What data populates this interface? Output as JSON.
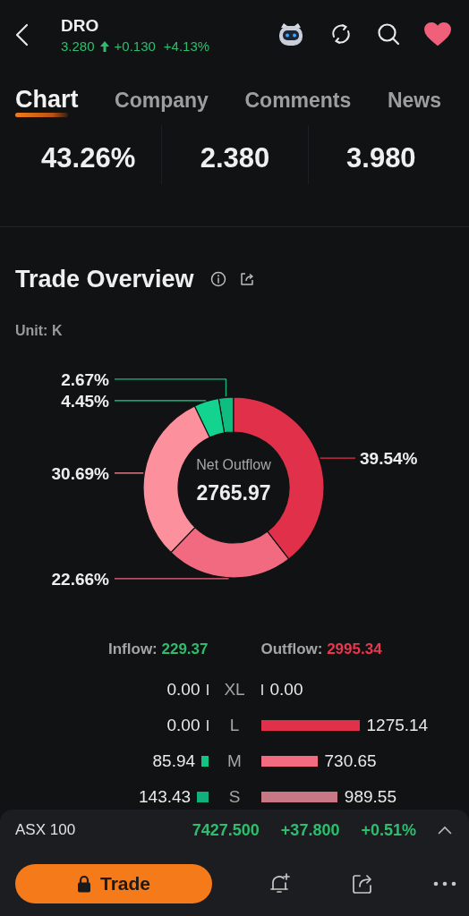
{
  "header": {
    "symbol": "DRO",
    "price": "3.280",
    "change": "+0.130",
    "change_percent": "+4.13%",
    "favorite": true
  },
  "tabs": [
    {
      "label": "Chart",
      "selected": true
    },
    {
      "label": "Company",
      "selected": false
    },
    {
      "label": "Comments",
      "selected": false
    },
    {
      "label": "News",
      "selected": false
    }
  ],
  "stats": [
    {
      "value": "43.26%"
    },
    {
      "value": "2.380"
    },
    {
      "value": "3.980"
    }
  ],
  "trade_overview": {
    "title": "Trade Overview",
    "unit": "Unit: K",
    "chart_data": {
      "type": "donut",
      "values": [
        2.67,
        4.45,
        30.69,
        22.66,
        39.54
      ]
    },
    "slices": [
      {
        "label": "2.67%",
        "color": "#0fbd7f"
      },
      {
        "label": "4.45%",
        "color": "#12d48f"
      },
      {
        "label": "30.69%",
        "color": "#fc909c"
      },
      {
        "label": "22.66%",
        "color": "#f26a7f"
      },
      {
        "label": "39.54%",
        "color": "#e0304a"
      }
    ],
    "center_label": "Net Outflow",
    "center_value": "2765.97",
    "inflow_label": "Inflow:",
    "inflow_value": "229.37",
    "outflow_label": "Outflow:",
    "outflow_value": "2995.34",
    "rows": [
      {
        "size": "XL",
        "inflow": {
          "value": "0.00"
        },
        "outflow": {
          "value": "0.00"
        }
      },
      {
        "size": "L",
        "inflow": {
          "value": "0.00"
        },
        "outflow": {
          "value": "1275.14",
          "color": "#e0304a"
        }
      },
      {
        "size": "M",
        "inflow": {
          "value": "85.94",
          "color": "#12c383"
        },
        "outflow": {
          "value": "730.65",
          "color": "#f26b80"
        }
      },
      {
        "size": "S",
        "inflow": {
          "value": "143.43",
          "color": "#10b07a"
        },
        "outflow": {
          "value": "989.55",
          "color": "#c77884"
        }
      }
    ]
  },
  "market_bar": {
    "name": "ASX 100",
    "value": "7427.500",
    "change": "+37.800",
    "change_percent": "+0.51%"
  },
  "toolbar": {
    "trade_label": "Trade"
  }
}
